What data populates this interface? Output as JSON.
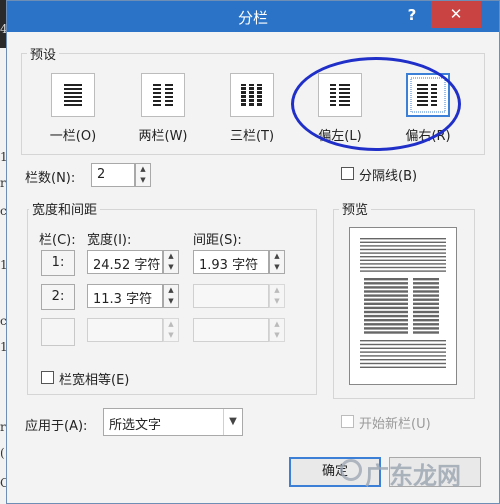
{
  "dialog": {
    "title": "分栏",
    "help": "?",
    "close": "✕"
  },
  "presets": {
    "group_label": "预设",
    "items": [
      {
        "label": "一栏(O)",
        "icon": "one-column-icon"
      },
      {
        "label": "两栏(W)",
        "icon": "two-columns-icon"
      },
      {
        "label": "三栏(T)",
        "icon": "three-columns-icon"
      },
      {
        "label": "偏左(L)",
        "icon": "left-column-icon"
      },
      {
        "label": "偏右(R)",
        "icon": "right-column-icon",
        "selected": true
      }
    ]
  },
  "column_count": {
    "label": "栏数(N):",
    "value": "2"
  },
  "separator": {
    "label": "分隔线(B)",
    "checked": false
  },
  "width_spacing": {
    "group_label": "宽度和间距",
    "col_header": "栏(C):",
    "width_header": "宽度(I):",
    "spacing_header": "间距(S):",
    "rows": [
      {
        "num": "1:",
        "width": "24.52 字符",
        "spacing": "1.93 字符"
      },
      {
        "num": "2:",
        "width": "11.3 字符",
        "spacing": ""
      },
      {
        "num": "",
        "width": "",
        "spacing": ""
      }
    ],
    "equal_width": {
      "label": "栏宽相等(E)",
      "checked": false
    }
  },
  "preview": {
    "label": "预览"
  },
  "apply_to": {
    "label": "应用于(A):",
    "value": "所选文字"
  },
  "new_column": {
    "label": "开始新栏(U)",
    "checked": false
  },
  "buttons": {
    "ok": "确定"
  },
  "watermark": "广东龙网",
  "background_doc": {
    "chars": [
      "4",
      "1",
      "r",
      "c",
      "1",
      "c",
      "1",
      "r",
      "(",
      "C"
    ]
  },
  "annotation_color": "#1f2fc8",
  "accent_color": "#2a73c6"
}
